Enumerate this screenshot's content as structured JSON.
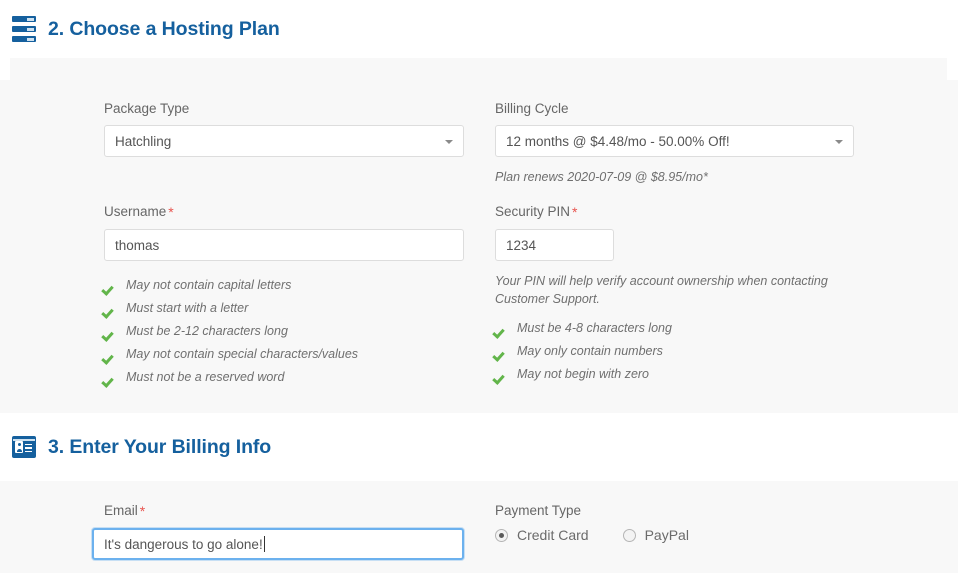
{
  "sections": [
    {
      "icon": "server-icon",
      "title": "2. Choose a Hosting Plan"
    },
    {
      "icon": "id-card-icon",
      "title": "3. Enter Your Billing Info"
    }
  ],
  "hosting_plan": {
    "package_type": {
      "label": "Package Type",
      "value": "Hatchling",
      "caret": "chevron-down-icon"
    },
    "billing_cycle": {
      "label": "Billing Cycle",
      "value": "12 months @ $4.48/mo - 50.00% Off!",
      "renewal_note": "Plan renews 2020-07-09 @ $8.95/mo*",
      "caret": "chevron-down-icon"
    },
    "username": {
      "label": "Username",
      "required_marker": "*",
      "value": "thomas",
      "rules": [
        "May not contain capital letters",
        "Must start with a letter",
        "Must be 2-12 characters long",
        "May not contain special characters/values",
        "Must not be a reserved word"
      ]
    },
    "security_pin": {
      "label": "Security PIN",
      "required_marker": "*",
      "value": "1234",
      "hint": "Your PIN will help verify account ownership when contacting Customer Support.",
      "rules": [
        "Must be 4-8 characters long",
        "May only contain numbers",
        "May not begin with zero"
      ]
    }
  },
  "billing_info": {
    "email": {
      "label": "Email",
      "required_marker": "*",
      "value": "It's dangerous to go alone!",
      "focused": true
    },
    "payment_type": {
      "label": "Payment Type",
      "options": [
        {
          "label": "Credit Card",
          "selected": true
        },
        {
          "label": "PayPal",
          "selected": false
        }
      ]
    }
  },
  "colors": {
    "heading_blue": "#15609e",
    "panel_gray": "#f8f8f8",
    "check_green": "#62b54a",
    "required_red": "#e8544f",
    "focus_blue": "#6cb1ee"
  }
}
